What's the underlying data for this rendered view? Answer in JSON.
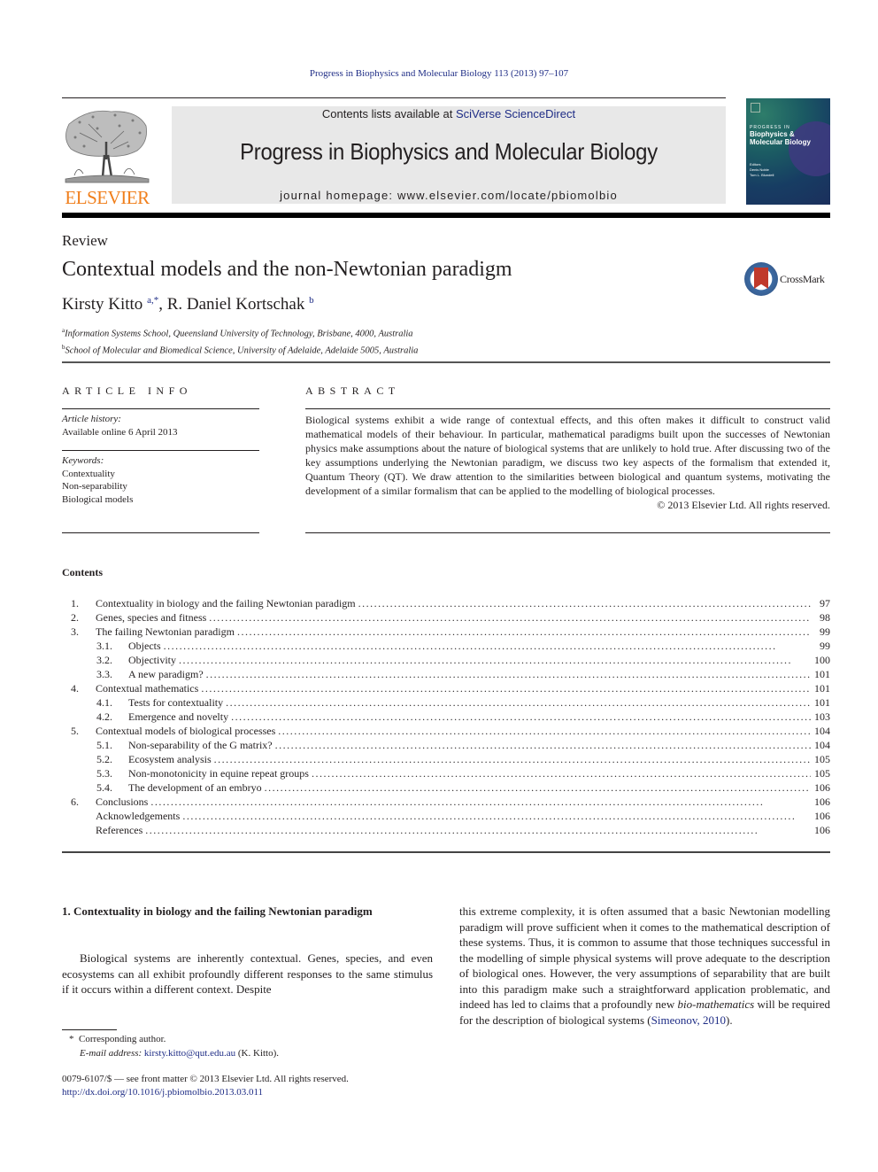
{
  "running_header": "Progress in Biophysics and Molecular Biology 113 (2013) 97–107",
  "masthead": {
    "contents_prefix": "Contents lists available at ",
    "contents_link": "SciVerse ScienceDirect",
    "journal_title": "Progress in Biophysics and Molecular Biology",
    "homepage": "journal homepage: www.elsevier.com/locate/pbiomolbio",
    "publisher_wordmark": "ELSEVIER",
    "publisher_color": "#f07f1c",
    "link_color": "#1f2d86"
  },
  "cover": {
    "small_caps": "PROGRESS IN",
    "title_line1": "Biophysics &",
    "title_line2": "Molecular Biology",
    "editors_label": "Editors",
    "editor1": "Denis Noble",
    "editor2": "Tom L. Blundell"
  },
  "crossmark": {
    "label": "CrossMark"
  },
  "article": {
    "type": "Review",
    "title": "Contextual models and the non-Newtonian paradigm",
    "authors": [
      {
        "name": "Kirsty Kitto",
        "marks": "a,*",
        "separator": ", "
      },
      {
        "name": "R. Daniel Kortschak",
        "marks": "b",
        "separator": ""
      }
    ],
    "affiliations": [
      {
        "mark": "a",
        "text": "Information Systems School, Queensland University of Technology, Brisbane, 4000, Australia"
      },
      {
        "mark": "b",
        "text": "School of Molecular and Biomedical Science, University of Adelaide, Adelaide 5005, Australia"
      }
    ]
  },
  "article_info": {
    "heading": "ARTICLE INFO",
    "history_label": "Article history:",
    "history_value": "Available online 6 April 2013",
    "keywords_label": "Keywords:",
    "keywords": [
      "Contextuality",
      "Non-separability",
      "Biological models"
    ]
  },
  "abstract": {
    "heading": "ABSTRACT",
    "text": "Biological systems exhibit a wide range of contextual effects, and this often makes it difficult to construct valid mathematical models of their behaviour. In particular, mathematical paradigms built upon the successes of Newtonian physics make assumptions about the nature of biological systems that are unlikely to hold true. After discussing two of the key assumptions underlying the Newtonian paradigm, we discuss two key aspects of the formalism that extended it, Quantum Theory (QT). We draw attention to the similarities between biological and quantum systems, motivating the development of a similar formalism that can be applied to the modelling of biological processes.",
    "copyright": "© 2013 Elsevier Ltd. All rights reserved."
  },
  "contents": {
    "heading": "Contents",
    "entries": [
      {
        "num": "1.",
        "title": "Contextuality in biology and the failing Newtonian paradigm",
        "page": "97",
        "level": 1
      },
      {
        "num": "2.",
        "title": "Genes, species and fitness",
        "page": "98",
        "level": 1
      },
      {
        "num": "3.",
        "title": "The failing Newtonian paradigm",
        "page": "99",
        "level": 1
      },
      {
        "num": "3.1.",
        "title": "Objects",
        "page": "99",
        "level": 2
      },
      {
        "num": "3.2.",
        "title": "Objectivity",
        "page": "100",
        "level": 2
      },
      {
        "num": "3.3.",
        "title": "A new paradigm?",
        "page": "101",
        "level": 2
      },
      {
        "num": "4.",
        "title": "Contextual mathematics",
        "page": "101",
        "level": 1
      },
      {
        "num": "4.1.",
        "title": "Tests for contextuality",
        "page": "101",
        "level": 2
      },
      {
        "num": "4.2.",
        "title": "Emergence and novelty",
        "page": "103",
        "level": 2
      },
      {
        "num": "5.",
        "title": "Contextual models of biological processes",
        "page": "104",
        "level": 1
      },
      {
        "num": "5.1.",
        "title": "Non-separability of the G matrix?",
        "page": "104",
        "level": 2
      },
      {
        "num": "5.2.",
        "title": "Ecosystem analysis",
        "page": "105",
        "level": 2
      },
      {
        "num": "5.3.",
        "title": "Non-monotonicity in equine repeat groups",
        "page": "105",
        "level": 2
      },
      {
        "num": "5.4.",
        "title": "The development of an embryo",
        "page": "106",
        "level": 2
      },
      {
        "num": "6.",
        "title": "Conclusions",
        "page": "106",
        "level": 1
      },
      {
        "num": "",
        "title": "Acknowledgements",
        "page": "106",
        "level": 1
      },
      {
        "num": "",
        "title": "References",
        "page": "106",
        "level": 1
      }
    ]
  },
  "section1": {
    "heading": "1.  Contextuality in biology and the failing Newtonian paradigm",
    "left_text": "Biological systems are inherently contextual. Genes, species, and even ecosystems can all exhibit profoundly different responses to the same stimulus if it occurs within a different context. Despite",
    "right_text_1": "this extreme complexity, it is often assumed that a basic Newtonian modelling paradigm will prove sufficient when it comes to the mathematical description of these systems. Thus, it is common to assume that those techniques successful in the modelling of simple physical systems will prove adequate to the description of biological ones. However, the very assumptions of separability that are built into this paradigm make such a straightforward application problematic, and indeed has led to claims that a profoundly new ",
    "right_italic": "bio-mathematics",
    "right_text_2": " will be required for the description of biological systems (",
    "right_citation": "Simeonov, 2010",
    "right_text_3": ")."
  },
  "footnotes": {
    "corresponding_mark": "*",
    "corresponding_text": "Corresponding author.",
    "email_label": "E-mail address:",
    "email": "kirsty.kitto@qut.edu.au",
    "email_suffix": " (K. Kitto)."
  },
  "front_matter": {
    "issn_line": "0079-6107/$ — see front matter © 2013 Elsevier Ltd. All rights reserved.",
    "doi": "http://dx.doi.org/10.1016/j.pbiomolbio.2013.03.011"
  }
}
